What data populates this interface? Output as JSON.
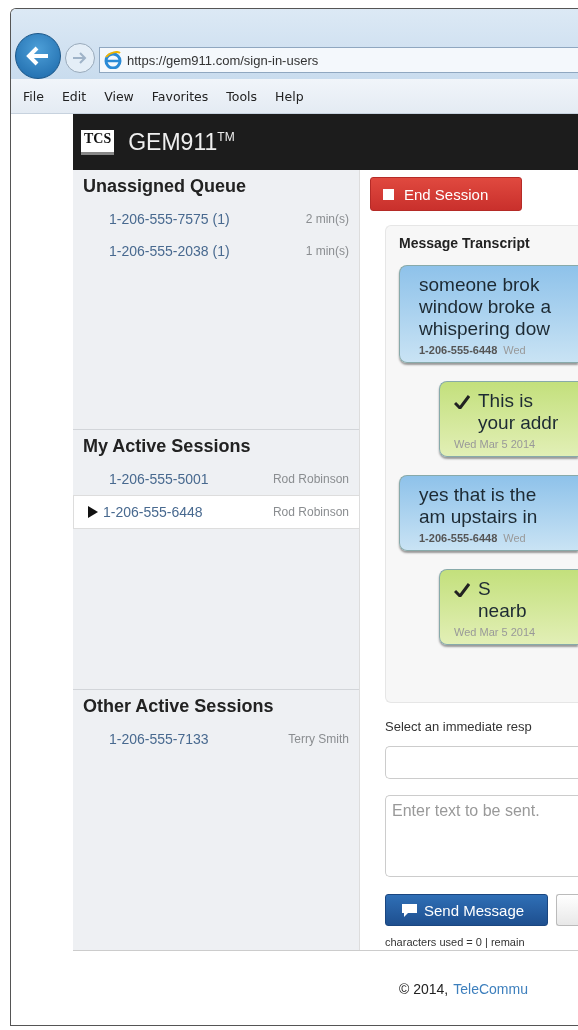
{
  "browser": {
    "url": "https://gem911.com/sign-in-users",
    "menu": [
      "File",
      "Edit",
      "View",
      "Favorites",
      "Tools",
      "Help"
    ]
  },
  "header": {
    "logo": "TCS",
    "title": "GEM911",
    "title_mark": "TM"
  },
  "sidebar": [
    {
      "title": "Unassigned Queue",
      "items": [
        {
          "number": "1-206-555-7575 (1)",
          "meta": "2 min(s)",
          "selected": false
        },
        {
          "number": "1-206-555-2038 (1)",
          "meta": "1 min(s)",
          "selected": false
        }
      ]
    },
    {
      "title": "My Active Sessions",
      "items": [
        {
          "number": "1-206-555-5001",
          "meta": "Rod Robinson",
          "selected": false
        },
        {
          "number": "1-206-555-6448",
          "meta": "Rod Robinson",
          "selected": true
        }
      ]
    },
    {
      "title": "Other Active Sessions",
      "items": [
        {
          "number": "1-206-555-7133",
          "meta": "Terry Smith",
          "selected": false
        }
      ]
    }
  ],
  "end_session": "End Session",
  "transcript": {
    "title": "Message Transcript",
    "messages": [
      {
        "kind": "incoming",
        "text": "someone brok\nwindow broke a\nwhispering dow",
        "sender": "1-206-555-6448",
        "time": "Wed"
      },
      {
        "kind": "outgoing",
        "text": "This is\nyour addr",
        "time": "Wed Mar 5 2014"
      },
      {
        "kind": "incoming",
        "text": "yes that is the\nam upstairs in",
        "sender": "1-206-555-6448",
        "time": "Wed"
      },
      {
        "kind": "outgoing",
        "text": "S\nnearb",
        "time": "Wed Mar 5 2014"
      }
    ]
  },
  "response_label": "Select an immediate resp",
  "message_field": {
    "placeholder": "Enter text to be sent."
  },
  "send_button": "Send Message",
  "char_count": "characters used = 0 | remain",
  "footer": {
    "copyright": "© 2014,",
    "link": "TeleCommu"
  }
}
